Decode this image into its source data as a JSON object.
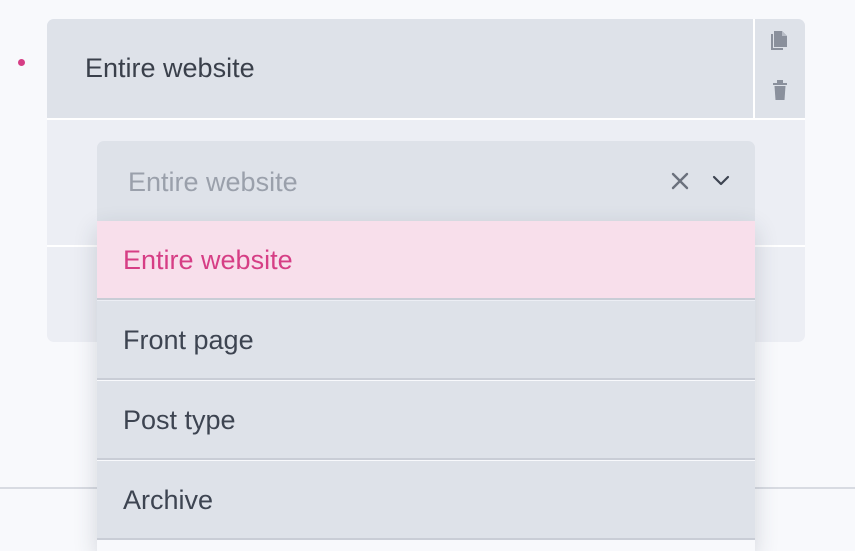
{
  "condition": {
    "title": "Entire website",
    "actions": {
      "copy_icon": "copy-icon",
      "delete_icon": "trash-icon"
    }
  },
  "select": {
    "placeholder": "Entire website",
    "clear_icon": "close-icon",
    "toggle_icon": "chevron-down-icon"
  },
  "dropdown": {
    "options": [
      {
        "label": "Entire website",
        "selected": true
      },
      {
        "label": "Front page",
        "selected": false
      },
      {
        "label": "Post type",
        "selected": false
      },
      {
        "label": "Archive",
        "selected": false
      }
    ]
  },
  "colors": {
    "accent": "#d63e85",
    "selected_bg": "#f8dfeb",
    "field_bg": "#dee2e9",
    "group_bg": "#eceef4",
    "page_bg": "#f8f9fc"
  }
}
